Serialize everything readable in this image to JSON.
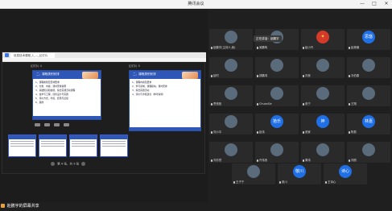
{
  "window": {
    "title": "腾讯会议",
    "min": "—",
    "max": "□",
    "close": "✕"
  },
  "share": {
    "tab_label": "信息技术课程_1_..._幻灯片",
    "slide_counter_left": "幻灯片 4",
    "slide_counter_right": "幻灯片 5",
    "page_text": "第 4 张，共 9 张",
    "slide_left": {
      "title": "二、课程类别安排",
      "lines": [
        "1、课程类别及安排要求",
        "2、分类、内容，课时安排说明",
        "3、基础知识和技能，综合实践活动课程",
        "4、技术与工程，创新设计与实践",
        "5、评价方式，考核，结果与反馈",
        "6、其他"
      ]
    },
    "slide_right": {
      "title": "二、课程类别安排",
      "lines": [
        "1、课程内容及要求",
        "2、学习领域，课程模块，课时安排",
        "3、综合实践活动",
        "4、评价与考核建议（参考资料）"
      ]
    },
    "sharing_label": "赵鹏宇的屏幕共享"
  },
  "tooltip": "正在讲话：赵鹏宇",
  "participants": [
    {
      "name": "赵鹏宇(主持人,我)",
      "avatar": "",
      "style": "photo"
    },
    {
      "name": "吴鹏鸣",
      "avatar": "",
      "style": "photo"
    },
    {
      "name": "赵小丹",
      "avatar": "",
      "style": "red"
    },
    {
      "name": "赵美娥",
      "avatar": "思悠",
      "style": "text"
    },
    {
      "name": "赵时",
      "avatar": "",
      "style": "photo"
    },
    {
      "name": "邵鹏鸿",
      "avatar": "",
      "style": "photo"
    },
    {
      "name": "刘良",
      "avatar": "",
      "style": "photo"
    },
    {
      "name": "冯伯春",
      "avatar": "",
      "style": "photo"
    },
    {
      "name": "贾悠悠",
      "avatar": "",
      "style": "photo"
    },
    {
      "name": "ChuanGe",
      "avatar": "",
      "style": "photo"
    },
    {
      "name": "张宁",
      "avatar": "",
      "style": "photo"
    },
    {
      "name": "王翔",
      "avatar": "",
      "style": "photo"
    },
    {
      "name": "刘小平",
      "avatar": "",
      "style": "photo"
    },
    {
      "name": "赵伟",
      "avatar": "拾乐",
      "style": "text"
    },
    {
      "name": "张家",
      "avatar": "神",
      "style": "text"
    },
    {
      "name": "陈振",
      "avatar": "林嘉",
      "style": "text"
    },
    {
      "name": "刘亦然",
      "avatar": "",
      "style": "photo"
    },
    {
      "name": "许伟良",
      "avatar": "",
      "style": "photo"
    },
    {
      "name": "周伟",
      "avatar": "",
      "style": "photo"
    },
    {
      "name": "刘丽",
      "avatar": "",
      "style": "photo"
    },
    {
      "name": "王子宁",
      "avatar": "",
      "style": "photo"
    },
    {
      "name": "张川",
      "avatar": "敬川",
      "style": "text"
    },
    {
      "name": "王诗心",
      "avatar": "诗心",
      "style": "text"
    }
  ]
}
